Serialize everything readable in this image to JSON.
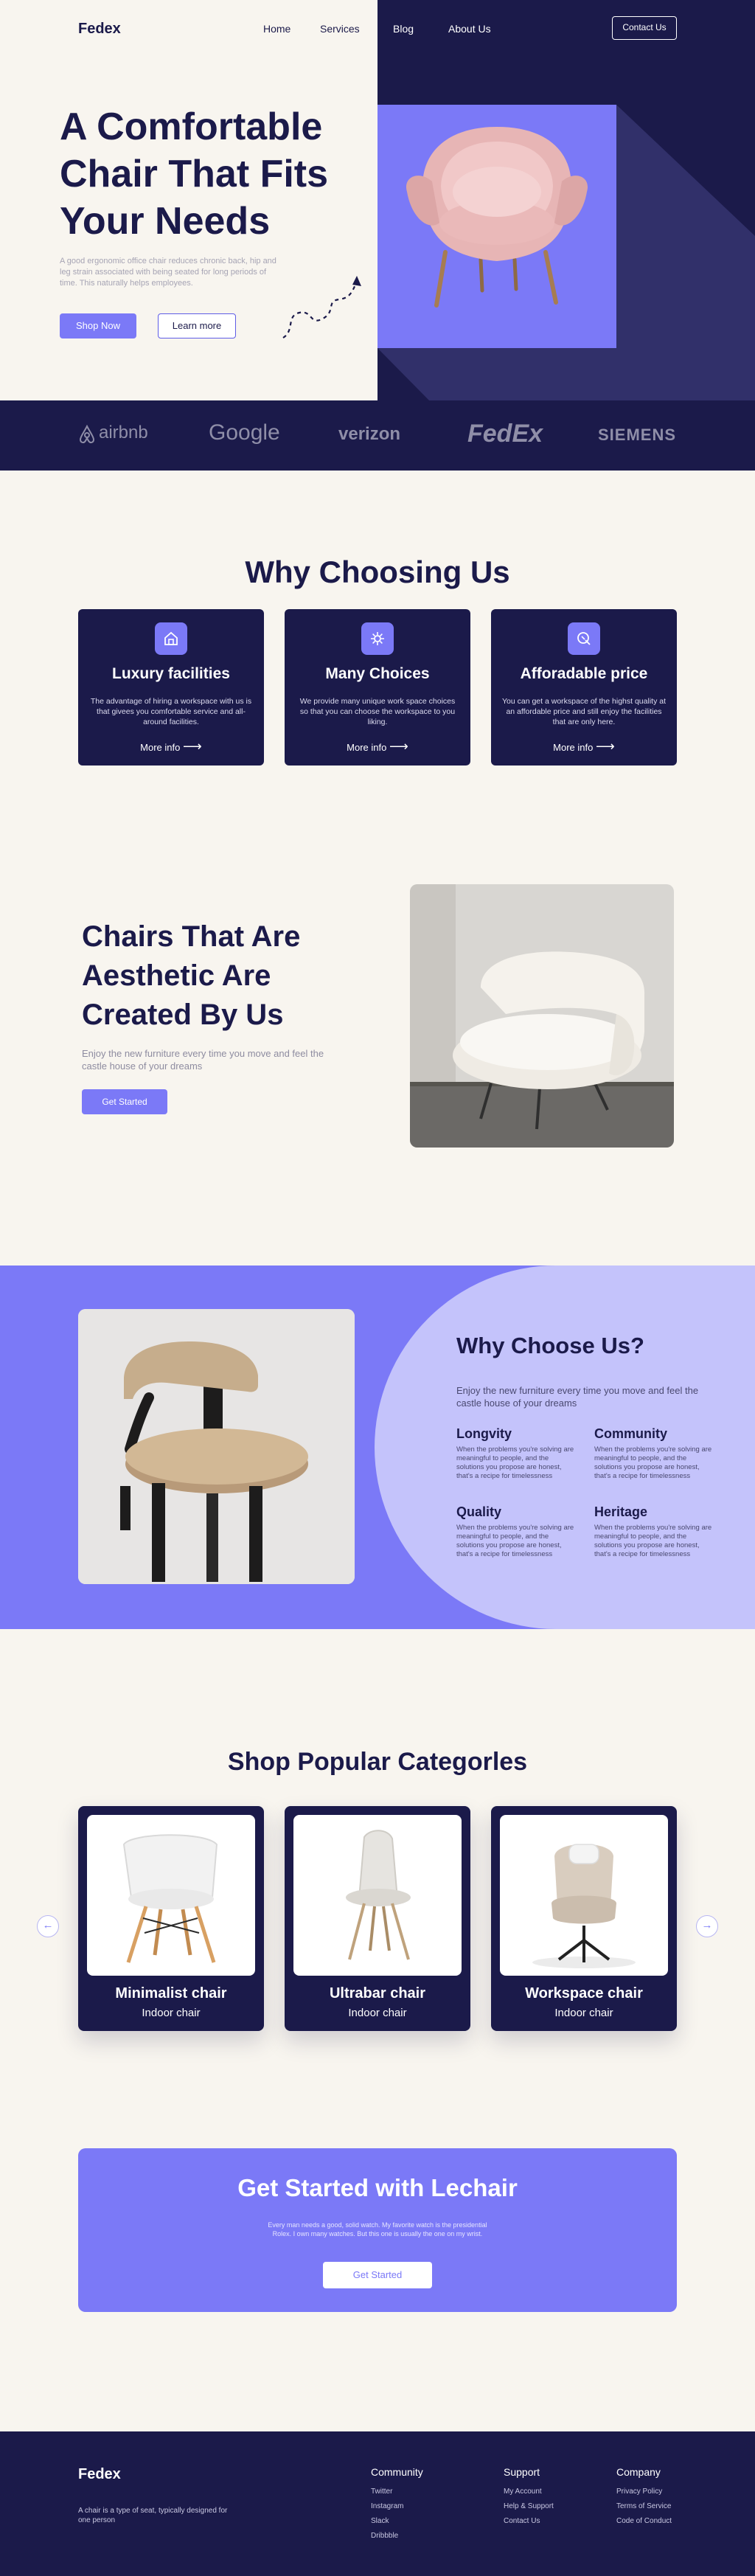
{
  "nav": {
    "logo": "Fedex",
    "links": [
      "Home",
      "Services",
      "Blog",
      "About Us"
    ],
    "contact": "Contact Us"
  },
  "hero": {
    "title": "A Comfortable Chair That Fits Your Needs",
    "description": "A good ergonomic office chair reduces chronic back, hip and leg strain associated with being seated for long periods of time. This naturally helps employees.",
    "primary_button": "Shop Now",
    "secondary_button": "Learn more",
    "image_alt": "pink armchair"
  },
  "brands": [
    "airbnb",
    "Google",
    "verizon",
    "FedEx",
    "SIEMENS"
  ],
  "why_choosing": {
    "title": "Why Choosing Us",
    "cards": [
      {
        "title": "Luxury facilities",
        "description": "The advantage of hiring a workspace with us is that givees you comfortable service and all-around facilities.",
        "link": "More info",
        "icon": "home-icon"
      },
      {
        "title": "Many Choices",
        "description": "We provide many unique work space choices so that you can choose the workspace to you liking.",
        "link": "More info",
        "icon": "settings-icon"
      },
      {
        "title": "Afforadable price",
        "description": "You can get a workspace of the highst quality at an affordable price and still enjoy the facilities that are only here.",
        "link": "More info",
        "icon": "price-icon"
      }
    ]
  },
  "aesthetic": {
    "title": "Chairs That Are Aesthetic Are Created By Us",
    "description": "Enjoy the new furniture every time you move and feel the castle house of your dreams",
    "button": "Get Started"
  },
  "why_choose_us": {
    "title": "Why Choose Us?",
    "description": "Enjoy the new furniture every time you move and feel the castle house of your dreams",
    "items": [
      {
        "title": "Longvity",
        "description": "When the problems you're solving are meaningful to people, and the solutions you propose are honest, that's a recipe for timelessness"
      },
      {
        "title": "Community",
        "description": "When the problems you're solving are meaningful to people, and the solutions you propose are honest, that's a recipe for timelessness"
      },
      {
        "title": "Quality",
        "description": "When the problems you're solving are meaningful to people, and the solutions you propose are honest, that's a recipe for timelessness"
      },
      {
        "title": "Heritage",
        "description": "When the problems you're solving are meaningful to people, and the solutions you propose are honest, that's a recipe for timelessness"
      }
    ]
  },
  "categories": {
    "title": "Shop Popular Categorles",
    "items": [
      {
        "name": "Minimalist chair",
        "subtitle": "Indoor chair"
      },
      {
        "name": "Ultrabar chair",
        "subtitle": "Indoor chair"
      },
      {
        "name": "Workspace chair",
        "subtitle": "Indoor chair"
      }
    ],
    "prev": "←",
    "next": "→"
  },
  "cta": {
    "title": "Get Started with Lechair",
    "description": "Every man needs a good, solid watch. My favorite watch is the presidential Rolex. I own many watches. But this one is usually the one on my wrist.",
    "button": "Get Started"
  },
  "footer": {
    "logo": "Fedex",
    "description": "A chair is a type of seat, typically designed for one person",
    "columns": [
      {
        "title": "Community",
        "links": [
          "Twitter",
          "Instagram",
          "Slack",
          "Dribbble"
        ]
      },
      {
        "title": "Support",
        "links": [
          "My Account",
          "Help & Support",
          "Contact Us"
        ]
      },
      {
        "title": "Company",
        "links": [
          "Privacy Policy",
          "Terms of Service",
          "Code of Conduct"
        ]
      }
    ]
  },
  "colors": {
    "navy": "#1b1a4a",
    "accent": "#7b79f7",
    "lavender": "#c4c3fb",
    "cream": "#f8f5ef"
  }
}
